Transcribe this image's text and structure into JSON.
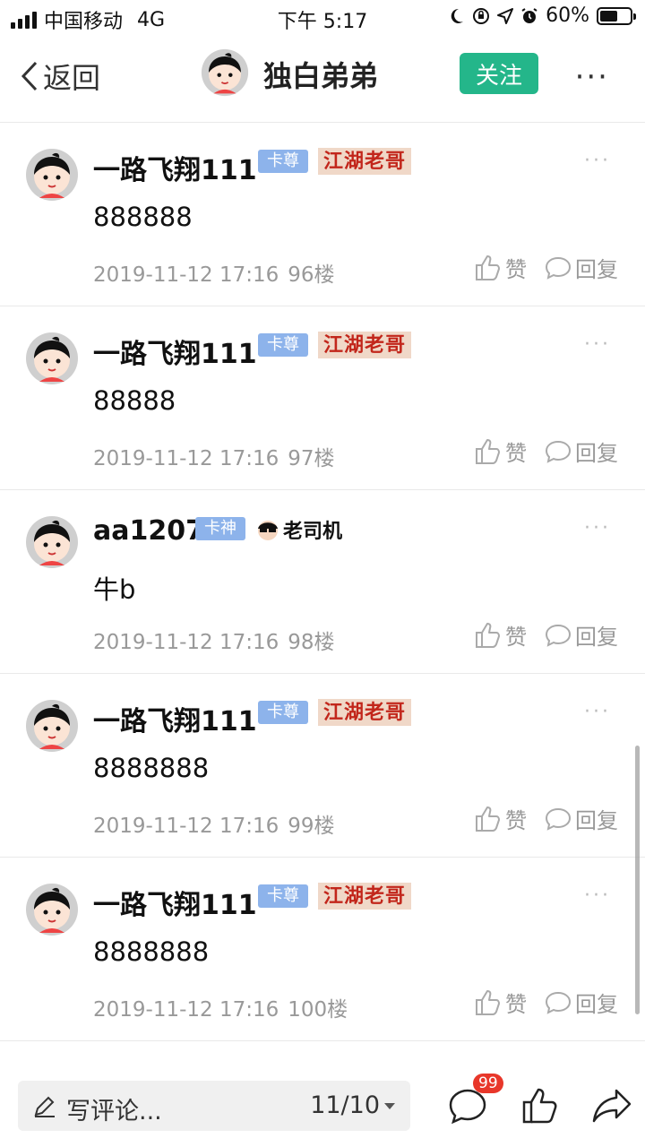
{
  "status_bar": {
    "carrier": "中国移动",
    "network": "4G",
    "time": "下午 5:17",
    "battery": "60%",
    "battery_level": 0.6
  },
  "nav": {
    "back_label": "返回",
    "title": "独白弟弟",
    "follow_label": "关注",
    "more_label": "···"
  },
  "comments": [
    {
      "user": "一路飞翔111",
      "rank": "卡尊",
      "title_badge": "江湖老哥",
      "title_badge_type": "jianghu",
      "text": "888888",
      "time": "2019-11-12 17:16",
      "floor": "96楼",
      "like_label": "赞",
      "reply_label": "回复"
    },
    {
      "user": "一路飞翔111",
      "rank": "卡尊",
      "title_badge": "江湖老哥",
      "title_badge_type": "jianghu",
      "text": "88888",
      "time": "2019-11-12 17:16",
      "floor": "97楼",
      "like_label": "赞",
      "reply_label": "回复"
    },
    {
      "user": "aa1207",
      "rank": "卡神",
      "title_badge": "老司机",
      "title_badge_type": "driver",
      "text": "牛b",
      "time": "2019-11-12 17:16",
      "floor": "98楼",
      "like_label": "赞",
      "reply_label": "回复"
    },
    {
      "user": "一路飞翔111",
      "rank": "卡尊",
      "title_badge": "江湖老哥",
      "title_badge_type": "jianghu",
      "text": "8888888",
      "time": "2019-11-12 17:16",
      "floor": "99楼",
      "like_label": "赞",
      "reply_label": "回复"
    },
    {
      "user": "一路飞翔111",
      "rank": "卡尊",
      "title_badge": "江湖老哥",
      "title_badge_type": "jianghu",
      "text": "8888888",
      "time": "2019-11-12 17:16",
      "floor": "100楼",
      "like_label": "赞",
      "reply_label": "回复"
    }
  ],
  "bottom_bar": {
    "compose_placeholder": "写评论...",
    "page_indicator": "11/10",
    "comment_count": "99",
    "icons": [
      "pen-icon",
      "comment-icon",
      "thumbs-up-icon",
      "share-icon"
    ]
  },
  "colors": {
    "accent": "#24b68a",
    "rank_badge": "#8db3eb",
    "title_badge": "#c2261b",
    "count_badge": "#e8372a"
  }
}
